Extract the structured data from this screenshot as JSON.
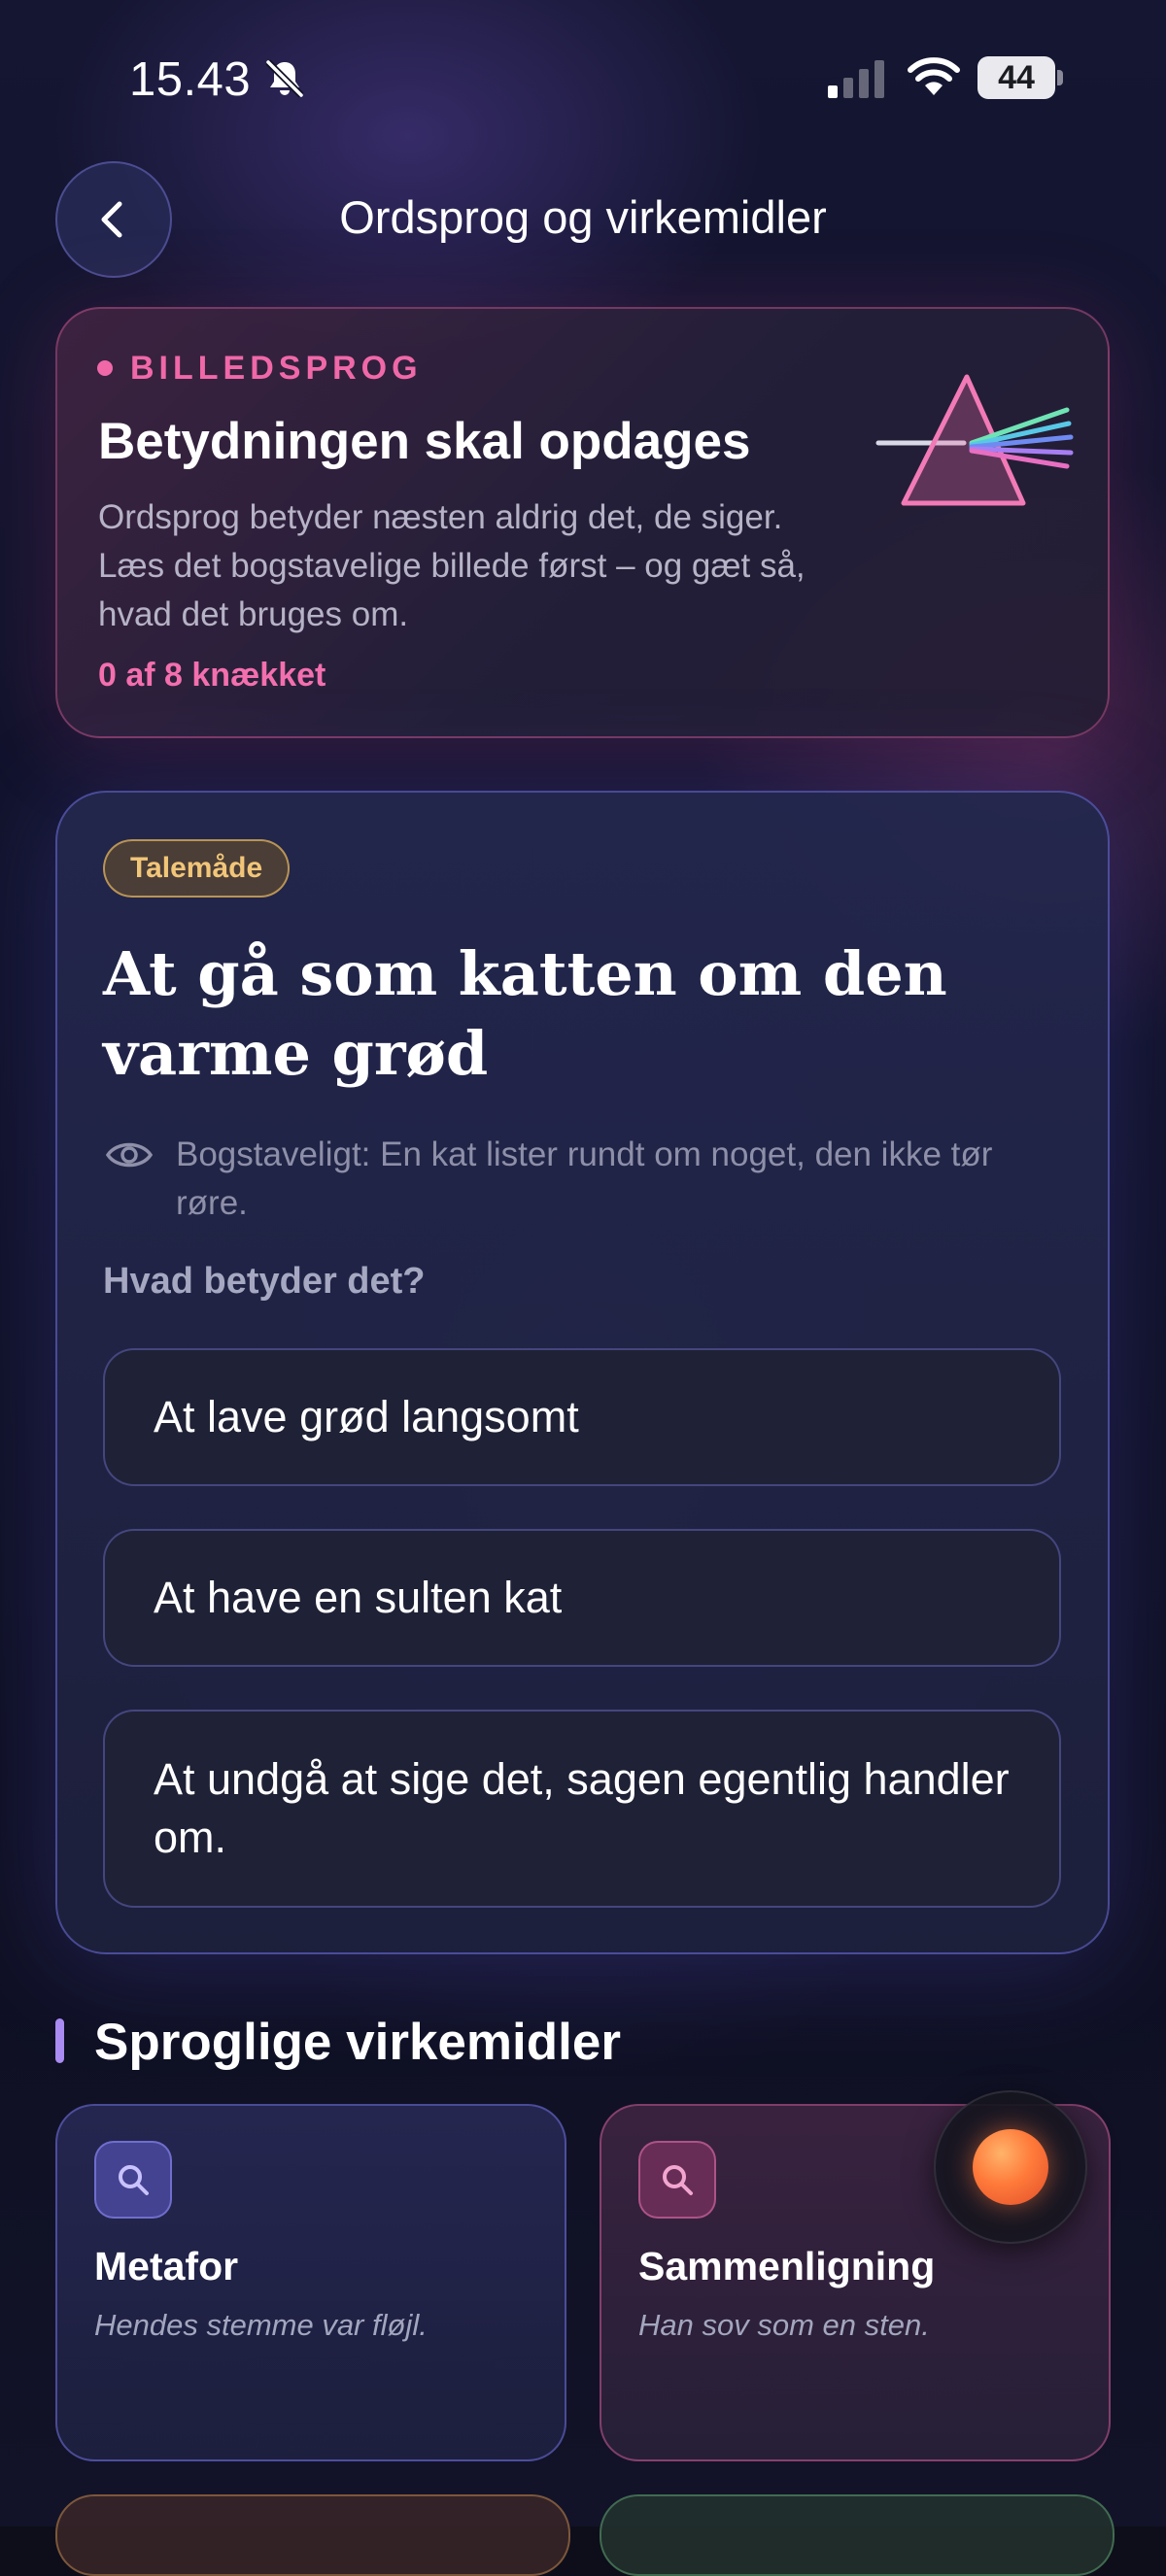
{
  "status_bar": {
    "time": "15.43",
    "battery": "44",
    "icons": [
      "bell-slash-icon",
      "cellular-signal-icon",
      "wifi-icon",
      "battery-icon"
    ]
  },
  "header": {
    "title": "Ordsprog og virkemidler",
    "back_icon": "chevron-left-icon"
  },
  "hero": {
    "eyebrow": "BILLEDSPROG",
    "title": "Betydningen skal opdages",
    "description": "Ordsprog betyder næsten aldrig det, de siger. Læs det bogstavelige billede først – og gæt så, hvad det bruges om.",
    "progress": "0 af 8 knækket",
    "illustration": "prism-icon",
    "accent_color": "#f068a8"
  },
  "quiz": {
    "badge": "Talemåde",
    "proverb": "At gå som katten om den varme grød",
    "literal": "Bogstaveligt: En kat lister rundt om noget, den ikke tør røre.",
    "literal_icon": "eye-icon",
    "question": "Hvad betyder det?",
    "options": [
      "At lave grød langsomt",
      "At have en sulten kat",
      "At undgå at sige det, sagen egentlig handler om."
    ]
  },
  "section": {
    "title": "Sproglige virkemidler",
    "accent_color": "#a98bf2"
  },
  "devices": [
    {
      "name": "Metafor",
      "example": "Hendes stemme var fløjl.",
      "icon": "search-icon"
    },
    {
      "name": "Sammenligning",
      "example": "Han sov som en sten.",
      "icon": "search-icon"
    }
  ],
  "floating_button": {
    "icon": "orb-icon",
    "color": "#ff7a3a"
  }
}
